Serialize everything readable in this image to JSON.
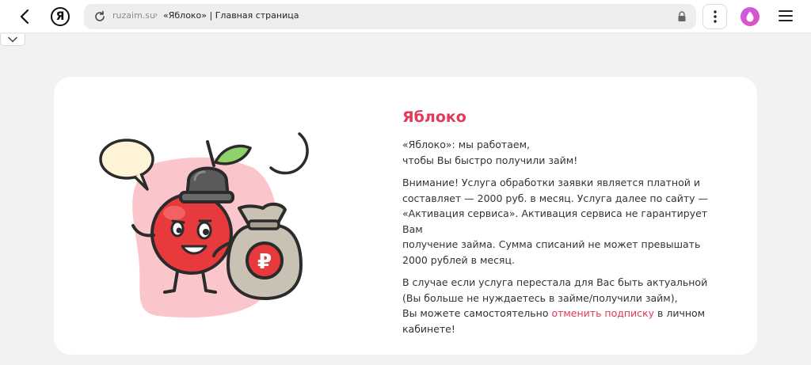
{
  "browser": {
    "domain": "ruzaim.su",
    "separator": "›",
    "page_title": "«Яблоко» | Главная страница",
    "logo_letter": "Я"
  },
  "colors": {
    "accent": "#e23a58",
    "card_bg": "#ffffff",
    "page_bg": "#f2f2f2"
  },
  "card": {
    "title": "Яблоко",
    "intro": [
      "«Яблоко»: мы работаем,",
      "чтобы Вы быстро получили займ!"
    ],
    "warning": [
      "Внимание! Услуга обработки заявки является платной и",
      "составляет — 2000 руб. в месяц. Услуга далее по сайту —",
      "«Активация сервиса». Активация сервиса не гарантирует Вам",
      "получение займа. Сумма списаний не может превышать",
      "2000 рублей в месяц."
    ],
    "cancel": {
      "line1": "В случае если услуга перестала для Вас быть актуальной",
      "line2": "(Вы больше не нуждаетесь в займе/получили займ),",
      "line3_before": "Вы можете самостоятельно ",
      "link_text": "отменить подписку",
      "line3_after": " в личном",
      "line4": "кабинете!"
    },
    "bag_symbol": "₽"
  },
  "icons": {
    "back": "back-arrow-icon",
    "reload": "reload-icon",
    "lock": "lock-icon",
    "menu": "vertical-dots-icon",
    "assistant": "alice-icon",
    "hamburger": "hamburger-icon",
    "collapse": "chevron-down-icon"
  }
}
